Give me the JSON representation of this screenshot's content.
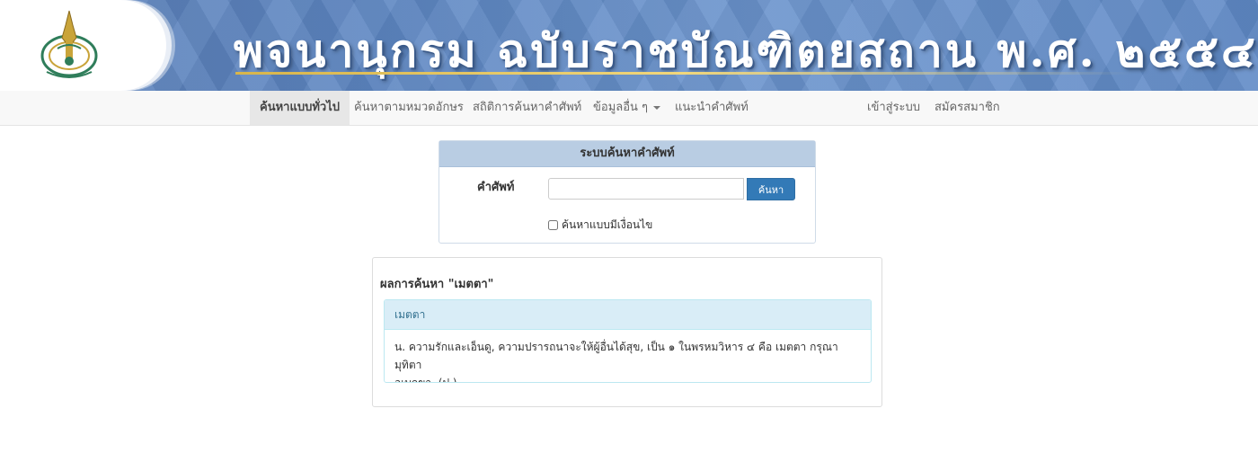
{
  "banner": {
    "title": "พจนานุกรม ฉบับราชบัณฑิตยสถาน พ.ศ. ๒๕๕๔"
  },
  "nav": {
    "items": [
      {
        "label": "ค้นหาแบบทั่วไป",
        "active": true
      },
      {
        "label": "ค้นหาตามหมวดอักษร"
      },
      {
        "label": "สถิติการค้นหาคำศัพท์"
      },
      {
        "label": "ข้อมูลอื่น ๆ",
        "dropdown": true
      },
      {
        "label": "แนะนำคำศัพท์"
      }
    ],
    "login": "เข้าสู่ระบบ",
    "register": "สมัครสมาชิก"
  },
  "search": {
    "panel_title": "ระบบค้นหาคำศัพท์",
    "term_label": "คำศัพท์",
    "term_value": "",
    "button": "ค้นหา",
    "advanced_label": "ค้นหาแบบมีเงื่อนไข",
    "advanced_checked": false
  },
  "results": {
    "title": "ผลการค้นหา \"เมตตา\"",
    "entries": [
      {
        "word": "เมตตา",
        "definition_line1": "น. ความรักและเอ็นดู, ความปรารถนาจะให้ผู้อื่นได้สุข, เป็น ๑ ในพรหมวิหาร ๔ คือ เมตตา กรุณา มุทิตา",
        "definition_line2": "อุเบกขา. (ป.)."
      }
    ]
  },
  "colors": {
    "banner_blue": "#5d86c2",
    "primary_button": "#337ab7",
    "panel_heading": "#b9cde3",
    "entry_heading": "#d9edf7"
  }
}
